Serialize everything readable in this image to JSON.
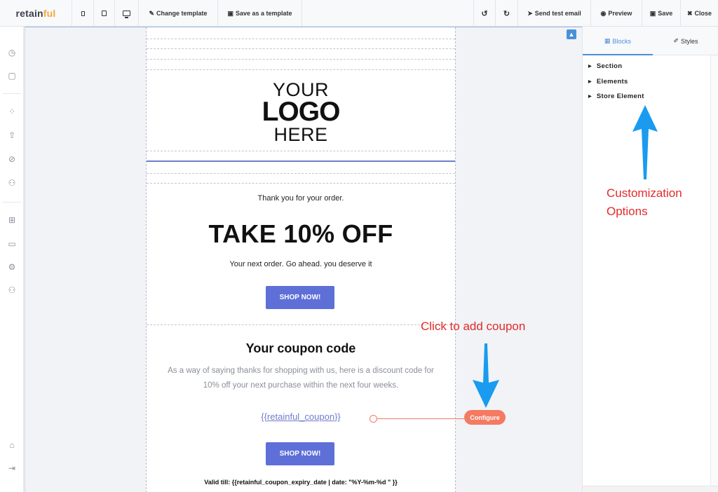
{
  "toolbar": {
    "brand_main": "retain",
    "brand_accent": "ful",
    "change_template": "Change template",
    "save_as_template": "Save as a template",
    "send_test_email": "Send test email",
    "preview": "Preview",
    "save": "Save",
    "close": "Close"
  },
  "email": {
    "logo_line1": "YOUR",
    "logo_line2": "LOGO",
    "logo_line3": "HERE",
    "thanks_text": "Thank you for your order.",
    "headline": "TAKE 10% OFF",
    "subline": "Your next order. Go ahead. you deserve it",
    "shop_button_1": "SHOP NOW!",
    "coupon_title": "Your coupon code",
    "coupon_description": "As a way of saying thanks for shopping with us, here is a discount code for 10% off your next purchase within the next four weeks.",
    "coupon_placeholder": "{{retainful_coupon}}",
    "shop_button_2": "SHOP NOW!",
    "valid_till": "Valid till: {{retainful_coupon_expiry_date | date: \"%Y-%m-%d \" }}"
  },
  "panel": {
    "tab_blocks": "Blocks",
    "tab_styles": "Styles",
    "items": [
      "Section",
      "Elements",
      "Store Element"
    ]
  },
  "annotations": {
    "configure_label": "Configure",
    "click_to_add": "Click to add coupon",
    "customization_line1": "Customization",
    "customization_line2": "Options"
  },
  "colors": {
    "accent_blue": "#4a90d9",
    "button_purple": "#5e6fd8",
    "annotation_red": "#e32a2a",
    "configure_orange": "#f47a61",
    "arrow_blue": "#1a9bf0"
  }
}
